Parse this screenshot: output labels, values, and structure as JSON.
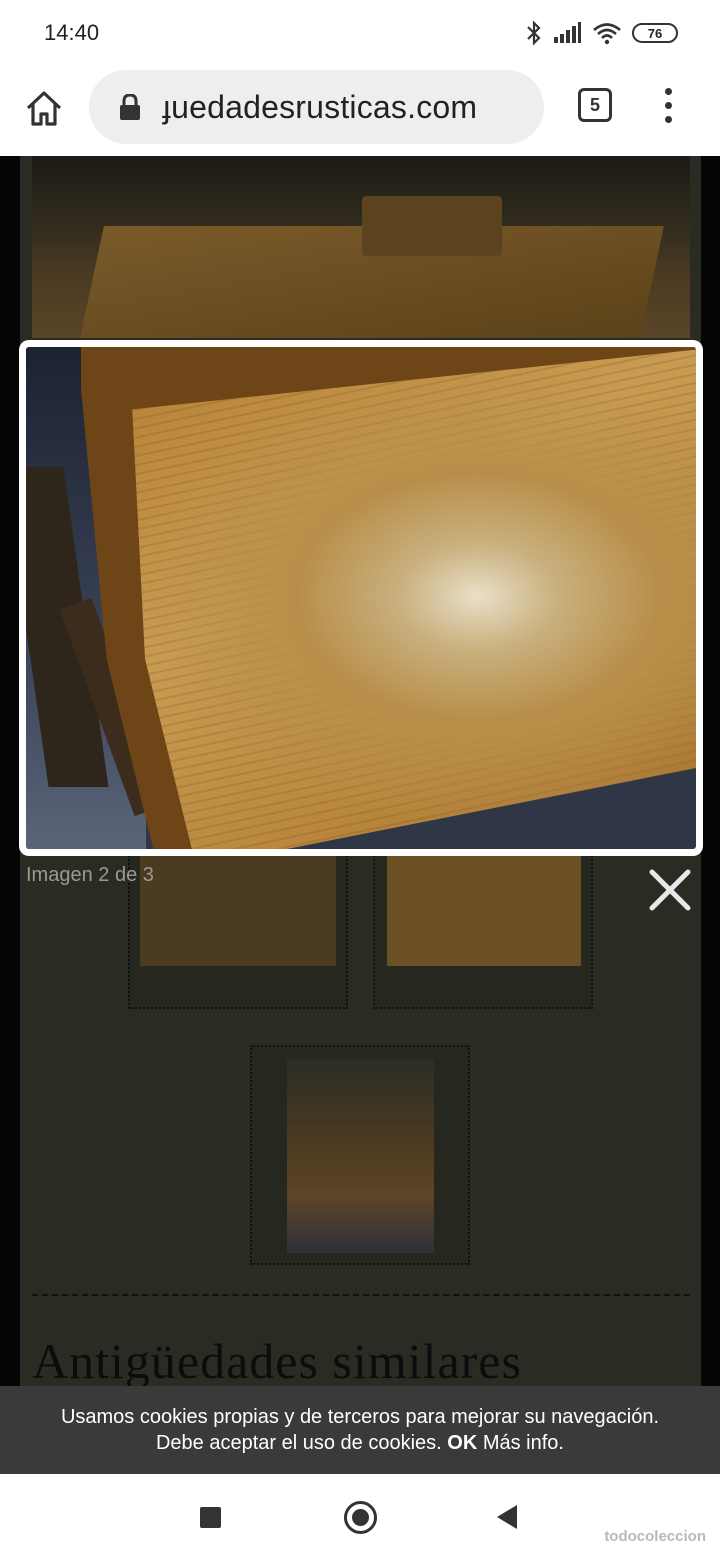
{
  "status_bar": {
    "time": "14:40",
    "battery": "76",
    "icons": [
      "bluetooth-icon",
      "signal-icon",
      "wifi-icon",
      "battery-icon"
    ]
  },
  "browser": {
    "url": "ɟuedadesrusticas.com",
    "tab_count": "5",
    "icons": [
      "home-icon",
      "lock-icon",
      "tabs-icon",
      "more-vert-icon"
    ]
  },
  "lightbox": {
    "caption": "Imagen 2 de 3",
    "image_alt_icon": "photo-table-top",
    "close_icon": "close-icon"
  },
  "page": {
    "section_heading": "Antigüedades similares"
  },
  "cookie_banner": {
    "text_line1": "Usamos cookies propias y de terceros para mejorar su navegación.",
    "text_line2": "Debe aceptar el uso de cookies.",
    "ok_label": "OK",
    "more_label": "Más info."
  },
  "nav_bar": {
    "watermark": "todocoleccion",
    "icons": [
      "recents-icon",
      "home-icon",
      "back-icon"
    ]
  }
}
